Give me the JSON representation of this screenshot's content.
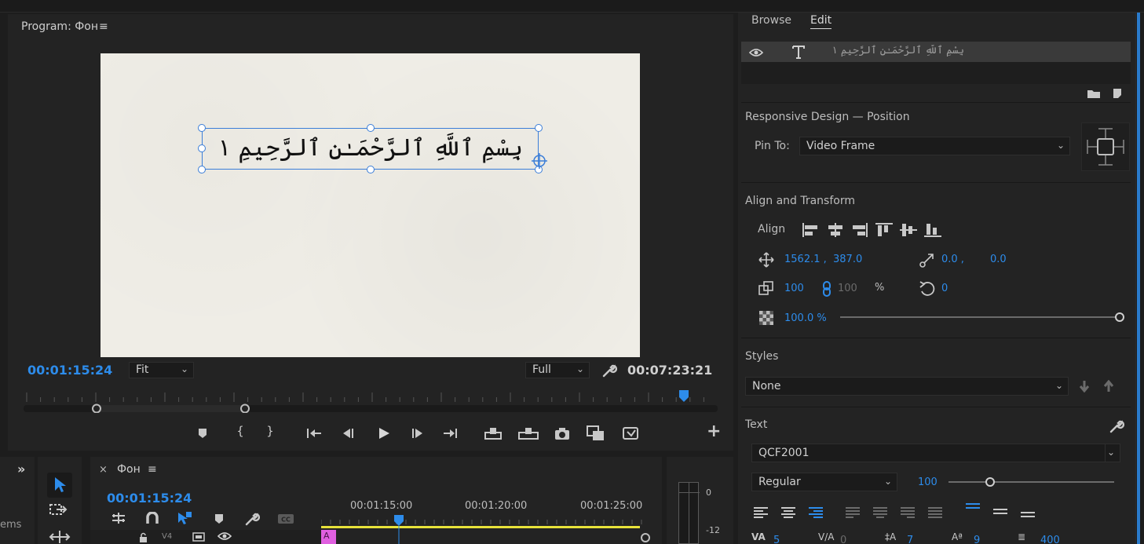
{
  "program": {
    "header": "Program: Фон",
    "menu_icon": "≡",
    "title_text": "بِسْمِ ٱللَّهِ ٱلرَّحْمَـٰنِ ٱلرَّحِيمِ ١",
    "timecode_current": "00:01:15:24",
    "fit_label": "Fit",
    "full_label": "Full",
    "timecode_duration": "00:07:23:21"
  },
  "transport": {
    "buttons": [
      "marker-icon",
      "in-point-icon",
      "out-point-icon",
      "go-to-in-icon",
      "step-back-icon",
      "play-icon",
      "step-forward-icon",
      "go-to-out-icon",
      "lift-icon",
      "extract-icon",
      "camera-icon",
      "comparison-icon",
      "multicam-icon"
    ],
    "add_label": "+"
  },
  "left_panel": {
    "expand_label": "»",
    "items_label": "ems"
  },
  "timeline": {
    "close_label": "×",
    "tab_label": "Фон",
    "menu_icon": "≡",
    "timecode": "00:01:15:24",
    "ruler": [
      "00:01:15:00",
      "00:01:20:00",
      "00:01:25:00"
    ],
    "track_label": "V4",
    "clip_label": "A"
  },
  "meter": {
    "labels": [
      "0",
      "-12"
    ]
  },
  "right": {
    "tab_browse": "Browse",
    "tab_edit": "Edit",
    "layer_name": "بِسْمِ ٱللَّهِ ٱلرَّحْمَـٰنِ ٱلرَّحِيمِ ١",
    "responsive_title": "Responsive Design — Position",
    "pin_to_label": "Pin To:",
    "pin_to_value": "Video Frame",
    "align_transform_title": "Align and Transform",
    "align_label": "Align",
    "pos_x": "1562.1 ,",
    "pos_y": "387.0",
    "anchor_x": "0.0 ,",
    "anchor_y": "0.0",
    "scale": "100",
    "scale_locked": "100",
    "scale_unit": "%",
    "rotation": "0",
    "opacity": "100.0 %",
    "opacity_fraction": 1.0,
    "styles_title": "Styles",
    "styles_value": "None",
    "text_title": "Text",
    "font_value": "QCF2001",
    "font_style": "Regular",
    "font_size": "100",
    "font_size_fraction": 0.25,
    "kerning": "5",
    "tracking": "0",
    "leading": "7",
    "baseline": "9",
    "tsume": "400"
  },
  "colors": {
    "accent": "#2d8ceb",
    "panel": "#232323",
    "background": "#1d1d1d",
    "selection": "#3b7ed8",
    "timeline_bar": "#e8e23a",
    "clip": "#e05fe0"
  }
}
